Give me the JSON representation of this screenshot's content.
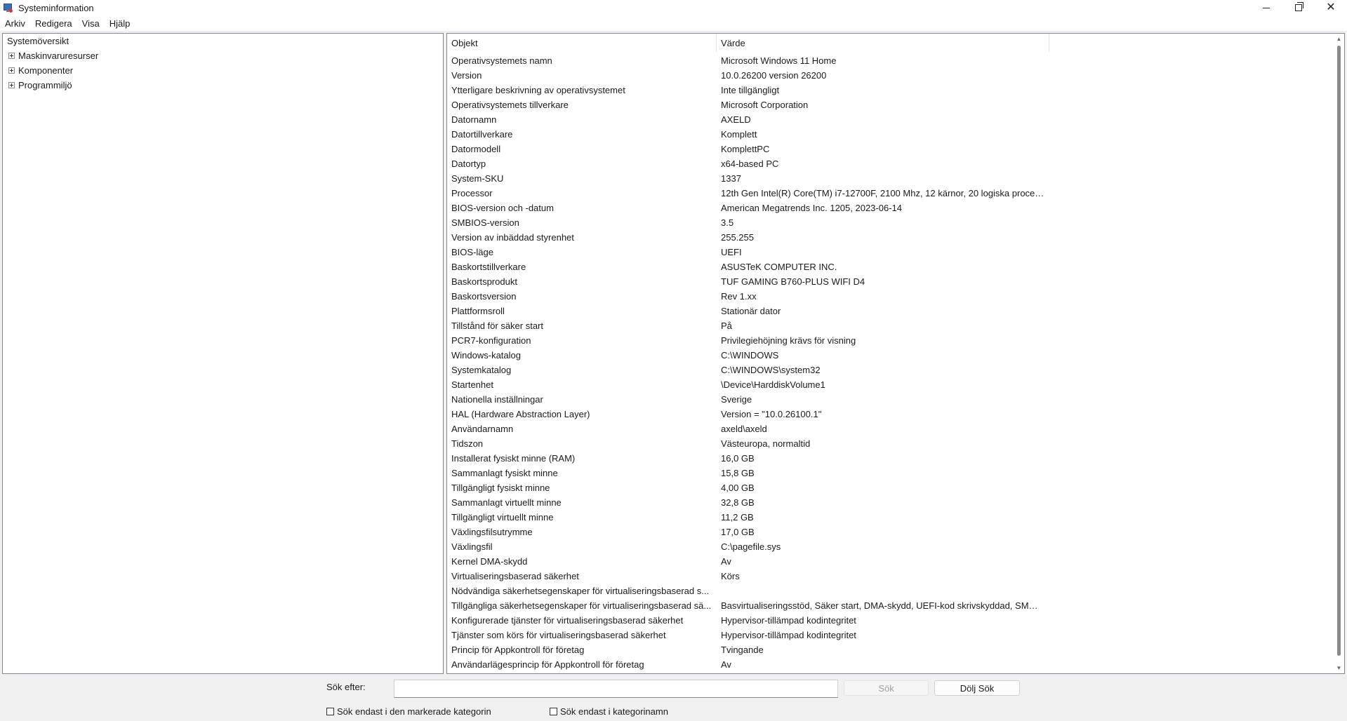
{
  "window": {
    "title": "Systeminformation"
  },
  "menu": [
    "Arkiv",
    "Redigera",
    "Visa",
    "Hjälp"
  ],
  "tree": {
    "root": "Systemöversikt",
    "children": [
      "Maskinvaruresurser",
      "Komponenter",
      "Programmiljö"
    ]
  },
  "list": {
    "headers": {
      "object": "Objekt",
      "value": "Värde"
    },
    "rows": [
      [
        "Operativsystemets namn",
        "Microsoft Windows 11 Home"
      ],
      [
        "Version",
        "10.0.26200 version 26200"
      ],
      [
        "Ytterligare beskrivning av operativsystemet",
        "Inte tillgängligt"
      ],
      [
        "Operativsystemets tillverkare",
        "Microsoft Corporation"
      ],
      [
        "Datornamn",
        "AXELD"
      ],
      [
        "Datortillverkare",
        "Komplett"
      ],
      [
        "Datormodell",
        "KomplettPC"
      ],
      [
        "Datortyp",
        "x64-based PC"
      ],
      [
        "System-SKU",
        "1337"
      ],
      [
        "Processor",
        "12th Gen Intel(R) Core(TM) i7-12700F, 2100 Mhz, 12 kärnor, 20 logiska proces..."
      ],
      [
        "BIOS-version och -datum",
        "American Megatrends Inc. 1205, 2023-06-14"
      ],
      [
        "SMBIOS-version",
        "3.5"
      ],
      [
        "Version av inbäddad styrenhet",
        "255.255"
      ],
      [
        "BIOS-läge",
        "UEFI"
      ],
      [
        "Baskortstillverkare",
        "ASUSTeK COMPUTER INC."
      ],
      [
        "Baskortsprodukt",
        "TUF GAMING B760-PLUS WIFI D4"
      ],
      [
        "Baskortsversion",
        "Rev 1.xx"
      ],
      [
        "Plattformsroll",
        "Stationär dator"
      ],
      [
        "Tillstånd för säker start",
        "På"
      ],
      [
        "PCR7-konfiguration",
        "Privilegiehöjning krävs för visning"
      ],
      [
        "Windows-katalog",
        "C:\\WINDOWS"
      ],
      [
        "Systemkatalog",
        "C:\\WINDOWS\\system32"
      ],
      [
        "Startenhet",
        "\\Device\\HarddiskVolume1"
      ],
      [
        "Nationella inställningar",
        "Sverige"
      ],
      [
        "HAL (Hardware Abstraction Layer)",
        "Version = \"10.0.26100.1\""
      ],
      [
        "Användarnamn",
        "axeld\\axeld"
      ],
      [
        "Tidszon",
        "Västeuropa, normaltid"
      ],
      [
        "Installerat fysiskt minne (RAM)",
        "16,0 GB"
      ],
      [
        "Sammanlagt fysiskt minne",
        "15,8 GB"
      ],
      [
        "Tillgängligt fysiskt minne",
        "4,00 GB"
      ],
      [
        "Sammanlagt virtuellt minne",
        "32,8 GB"
      ],
      [
        "Tillgängligt virtuellt minne",
        "11,2 GB"
      ],
      [
        "Växlingsfilsutrymme",
        "17,0 GB"
      ],
      [
        "Växlingsfil",
        "C:\\pagefile.sys"
      ],
      [
        "Kernel DMA-skydd",
        "Av"
      ],
      [
        "Virtualiseringsbaserad säkerhet",
        "Körs"
      ],
      [
        "Nödvändiga säkerhetsegenskaper för virtualiseringsbaserad s...",
        ""
      ],
      [
        "Tillgängliga säkerhetsegenskaper för virtualiseringsbaserad sä...",
        "Basvirtualiseringsstöd, Säker start, DMA-skydd, UEFI-kod skrivskyddad, SMM ..."
      ],
      [
        "Konfigurerade tjänster för virtualiseringsbaserad säkerhet",
        "Hypervisor-tillämpad kodintegritet"
      ],
      [
        "Tjänster som körs för virtualiseringsbaserad säkerhet",
        "Hypervisor-tillämpad kodintegritet"
      ],
      [
        "Princip för Appkontroll för företag",
        "Tvingande"
      ],
      [
        "Användarlägesprincip för Appkontroll för företag",
        "Av"
      ]
    ]
  },
  "search": {
    "label": "Sök efter:",
    "value": "",
    "search_button": "Sök",
    "hide_button": "Dölj Sök",
    "checkbox_selected_category": "Sök endast i den markerade kategorin",
    "checkbox_category_names": "Sök endast i kategorinamn"
  }
}
